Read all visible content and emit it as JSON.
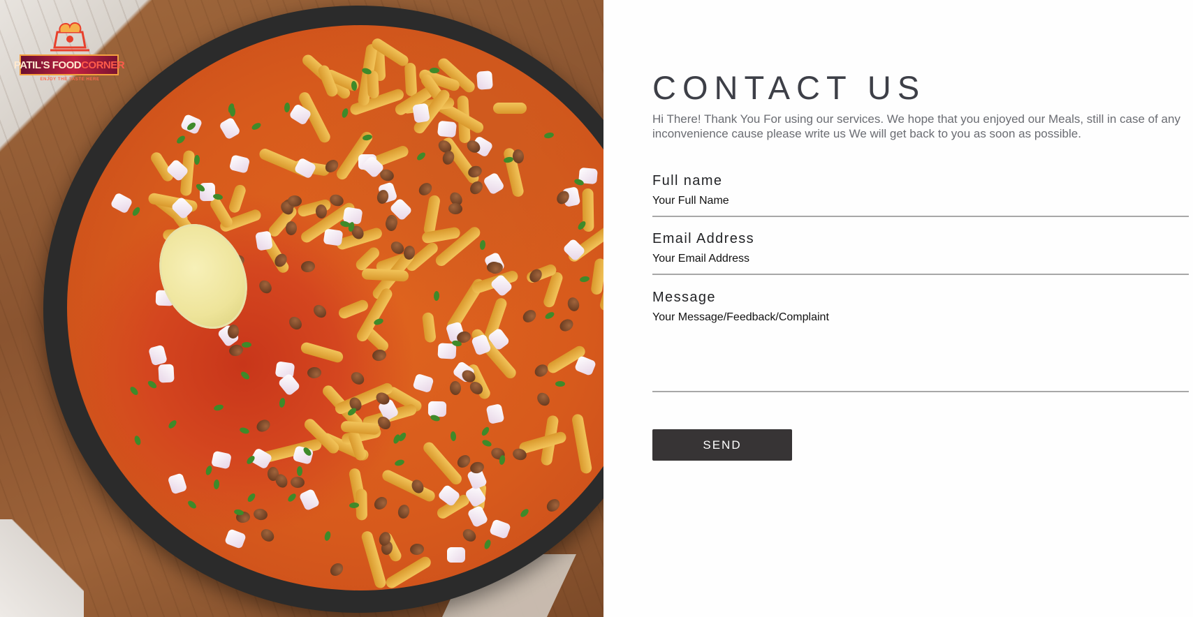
{
  "brand": {
    "name_part1": "PATIL'S FOOD",
    "name_part2": "CORNER",
    "tagline": "ENJOY THE TASTE HERE",
    "colors": {
      "banner": "#c02040",
      "accent": "#ff5b4a",
      "outline": "#f4a040"
    }
  },
  "hero": {
    "image_icon": "food-bowl-photo"
  },
  "contact": {
    "title": "CONTACT US",
    "intro": "Hi There! Thank You For using our services. We hope that you enjoyed our Meals, still in case of any inconvenience cause please write us We will get back to you as soon as possible.",
    "fields": {
      "full_name": {
        "label": "Full name",
        "placeholder": "Your Full Name"
      },
      "email": {
        "label": "Email Address",
        "placeholder": "Your Email Address"
      },
      "message": {
        "label": "Message",
        "placeholder": "Your Message/Feedback/Complaint"
      }
    },
    "send_label": "SEND",
    "colors": {
      "title": "#3d3f47",
      "button": "#373435",
      "underline": "#a7a7a7"
    }
  }
}
